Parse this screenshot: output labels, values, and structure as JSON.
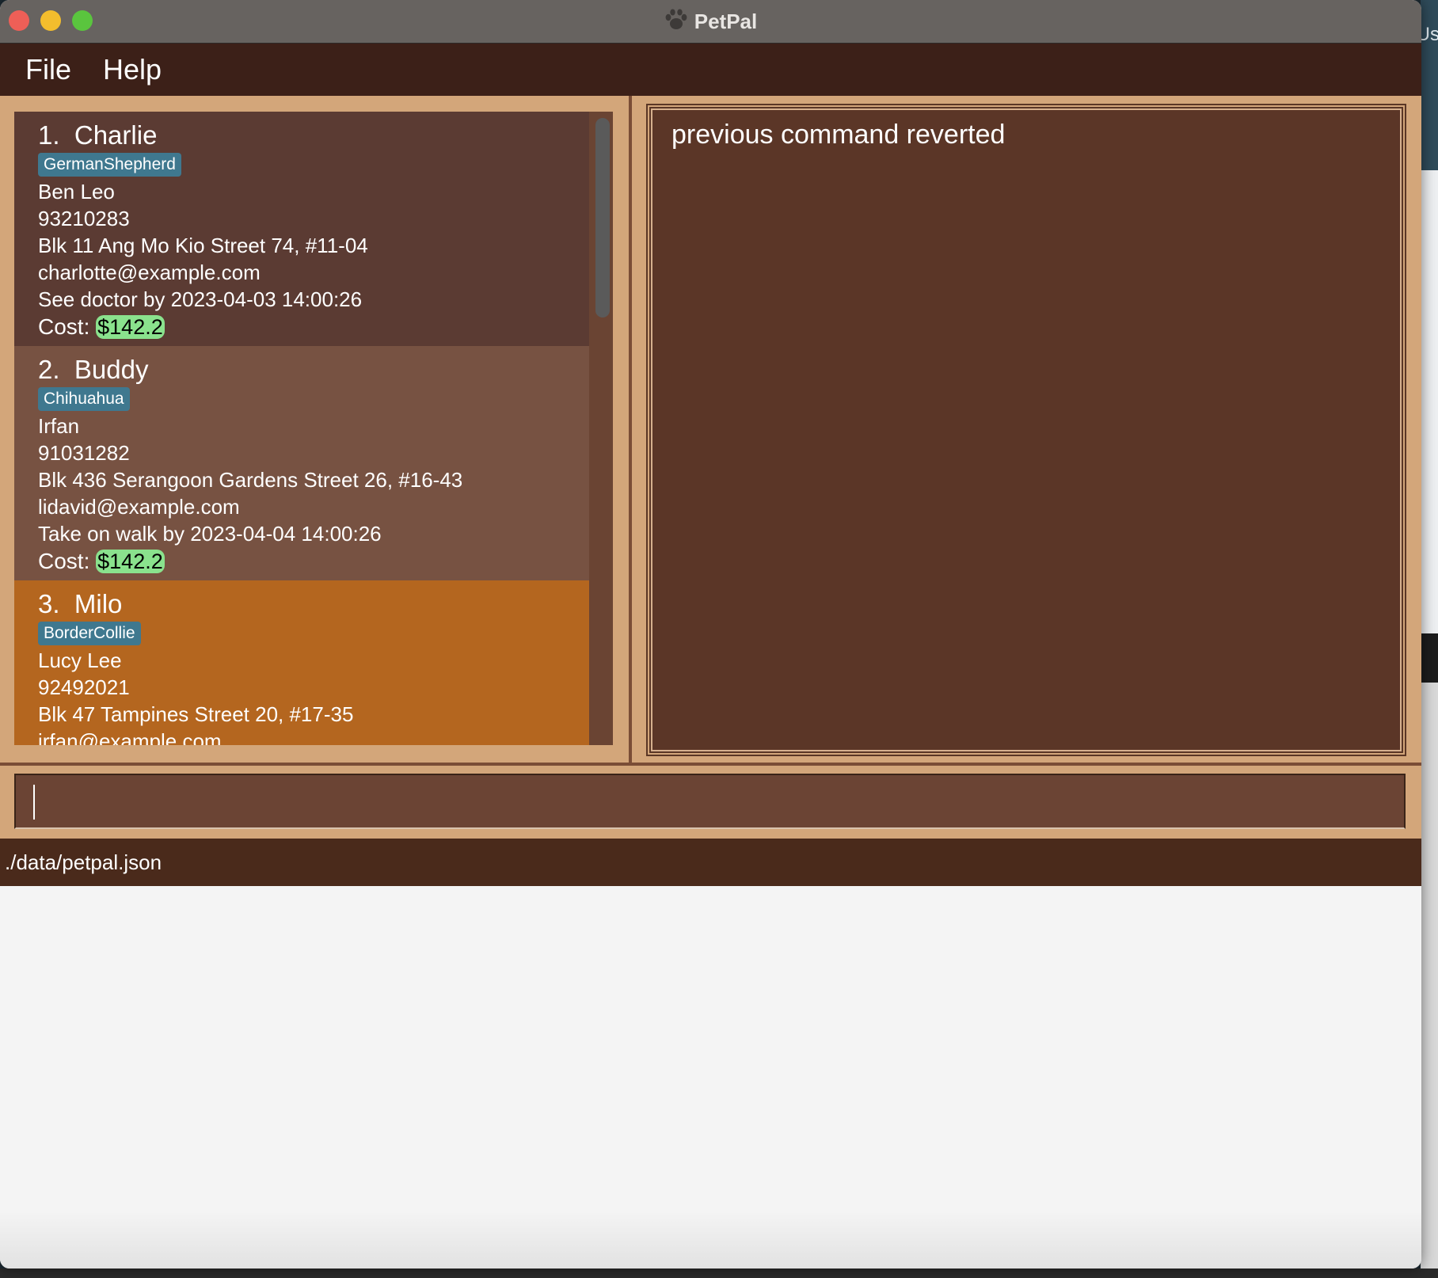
{
  "window": {
    "title": "PetPal"
  },
  "background": {
    "edge_text": "Us"
  },
  "menubar": {
    "items": [
      {
        "label": "File"
      },
      {
        "label": "Help"
      }
    ]
  },
  "pet_list": [
    {
      "index": "1.",
      "name": "Charlie",
      "tag": "GermanShepherd",
      "owner": "Ben Leo",
      "phone": "93210283",
      "address": "Blk 11 Ang Mo Kio Street 74, #11-04",
      "email": "charlotte@example.com",
      "reminder": "See doctor by 2023-04-03 14:00:26",
      "cost_label": "Cost:",
      "cost": "$142.2",
      "bg_color": "#5b3b33"
    },
    {
      "index": "2.",
      "name": "Buddy",
      "tag": "Chihuahua",
      "owner": "Irfan",
      "phone": "91031282",
      "address": "Blk 436 Serangoon Gardens Street 26, #16-43",
      "email": "lidavid@example.com",
      "reminder": "Take on walk by 2023-04-04 14:00:26",
      "cost_label": "Cost:",
      "cost": "$142.2",
      "bg_color": "#775242"
    },
    {
      "index": "3.",
      "name": "Milo",
      "tag": "BorderCollie",
      "owner": "Lucy Lee",
      "phone": "92492021",
      "address": "Blk 47 Tampines Street 20, #17-35",
      "email": "irfan@example.com",
      "bg_color": "#b4661f"
    }
  ],
  "result_display": {
    "message": "previous command reverted"
  },
  "command_box": {
    "value": ""
  },
  "status_bar": {
    "path": "./data/petpal.json"
  },
  "colors": {
    "menubar_bg": "#3c2018",
    "panel_bg": "#d3a67a",
    "result_bg": "#5b3627",
    "tag_bg": "#3f788f",
    "cost_badge_bg": "#8ae28d",
    "selected_card_bg": "#b4661f"
  }
}
